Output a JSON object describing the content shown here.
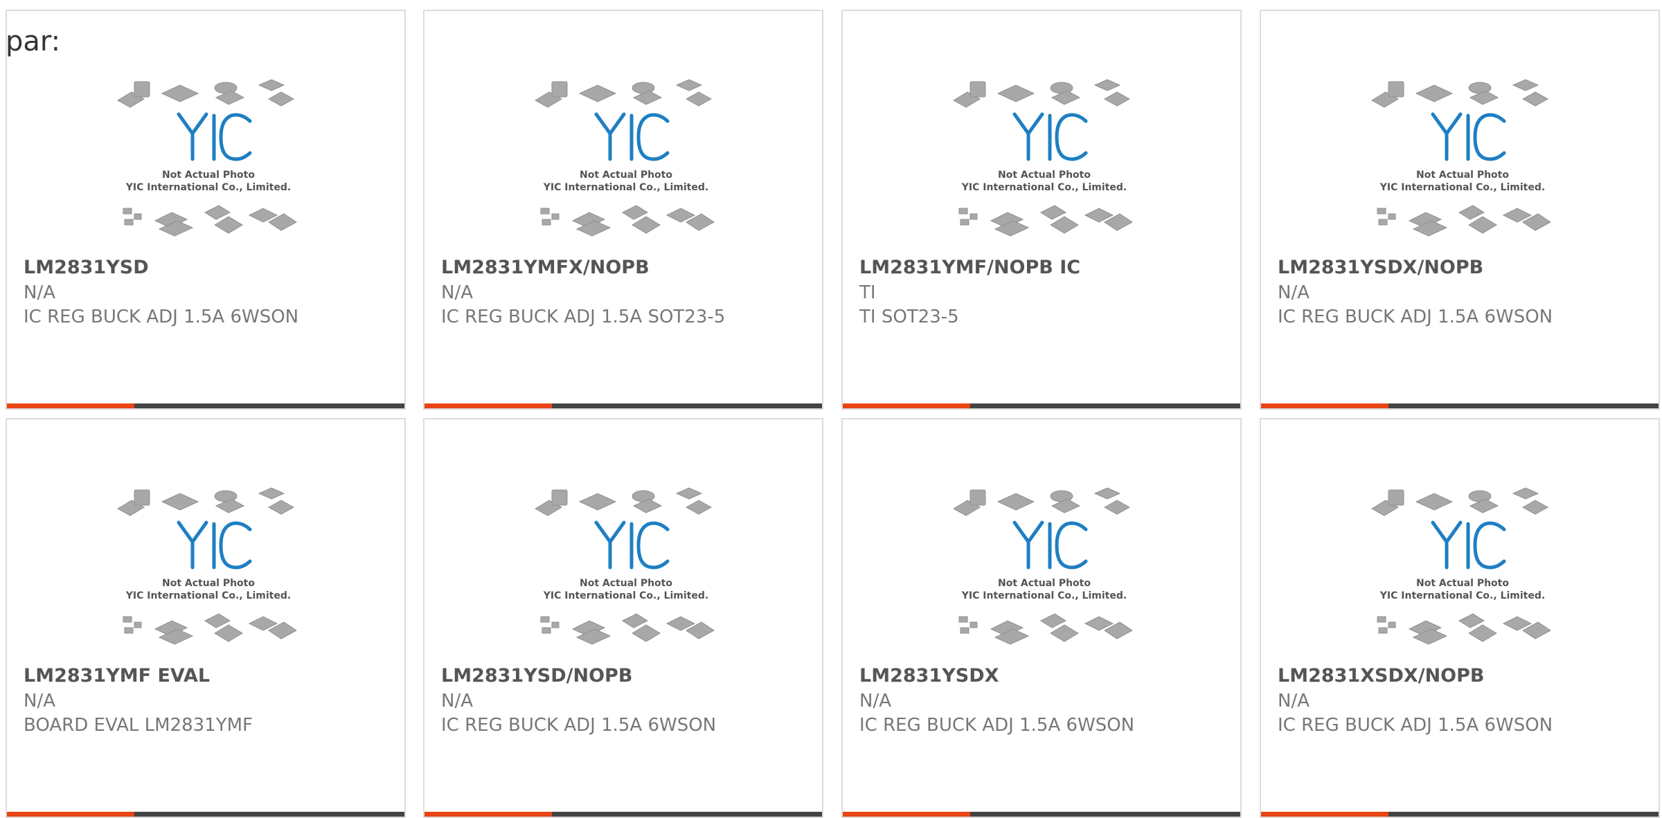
{
  "header": {
    "label": "par:"
  },
  "placeholder": {
    "brand": "YIC",
    "line1": "Not Actual Photo",
    "line2": "YIC International Co., Limited."
  },
  "colors": {
    "accent": "#e84414",
    "bar": "#444444",
    "logo": "#1e7fc2"
  },
  "cards": [
    {
      "title": "LM2831YSD",
      "maker": "N/A",
      "desc": "IC REG BUCK ADJ 1.5A 6WSON",
      "progress": 0.32
    },
    {
      "title": "LM2831YMFX/NOPB",
      "maker": "N/A",
      "desc": "IC REG BUCK ADJ 1.5A SOT23-5",
      "progress": 0.32
    },
    {
      "title": "LM2831YMF/NOPB IC",
      "maker": "TI",
      "desc": "TI SOT23-5",
      "progress": 0.32
    },
    {
      "title": "LM2831YSDX/NOPB",
      "maker": "N/A",
      "desc": "IC REG BUCK ADJ 1.5A 6WSON",
      "progress": 0.32
    },
    {
      "title": "LM2831YMF EVAL",
      "maker": "N/A",
      "desc": "BOARD EVAL LM2831YMF",
      "progress": 0.32
    },
    {
      "title": "LM2831YSD/NOPB",
      "maker": "N/A",
      "desc": "IC REG BUCK ADJ 1.5A 6WSON",
      "progress": 0.32
    },
    {
      "title": "LM2831YSDX",
      "maker": "N/A",
      "desc": "IC REG BUCK ADJ 1.5A 6WSON",
      "progress": 0.32
    },
    {
      "title": "LM2831XSDX/NOPB",
      "maker": "N/A",
      "desc": "IC REG BUCK ADJ 1.5A 6WSON",
      "progress": 0.32
    }
  ]
}
